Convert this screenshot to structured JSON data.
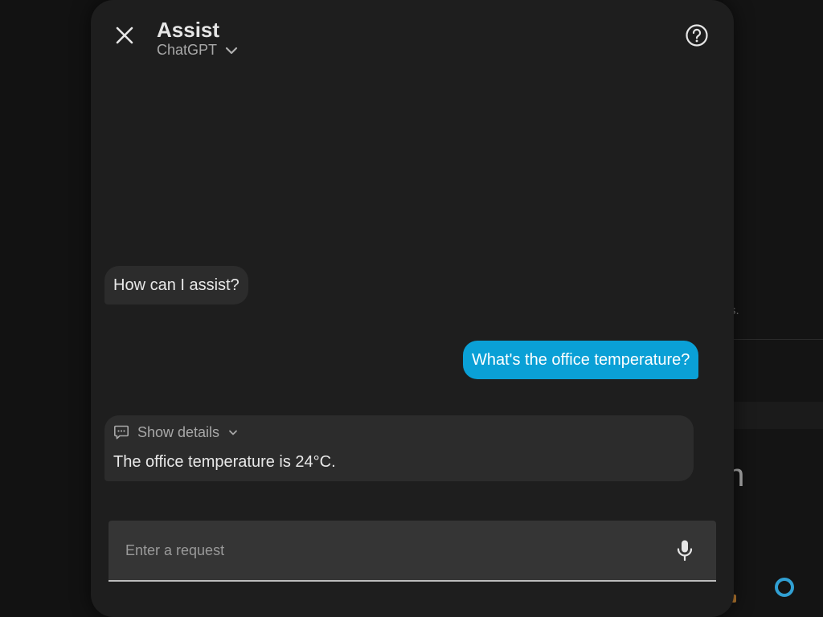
{
  "dialog": {
    "title": "Assist",
    "pipeline": {
      "selected": "ChatGPT"
    },
    "icons": {
      "close": "close-icon",
      "help": "help-circle-icon",
      "dropdown": "chevron-down-icon",
      "details": "comment-processing-icon",
      "mic": "microphone-icon"
    }
  },
  "conversation": {
    "messages": [
      {
        "role": "assistant",
        "text": "How can I assist?"
      },
      {
        "role": "user",
        "text": "What's the office temperature?"
      },
      {
        "role": "assistant",
        "details_label": "Show details",
        "text": "The office temperature is 24°C."
      }
    ]
  },
  "input": {
    "placeholder": "Enter a request",
    "value": ""
  },
  "background": {
    "fragment_s": "s.",
    "fragment_th": "th"
  },
  "colors": {
    "dialog_bg": "#1e1e1e",
    "assistant_bubble": "#2c2c2c",
    "user_bubble": "#0aa0d6",
    "input_bg": "#353535",
    "accent_ring": "#31a0d3"
  }
}
